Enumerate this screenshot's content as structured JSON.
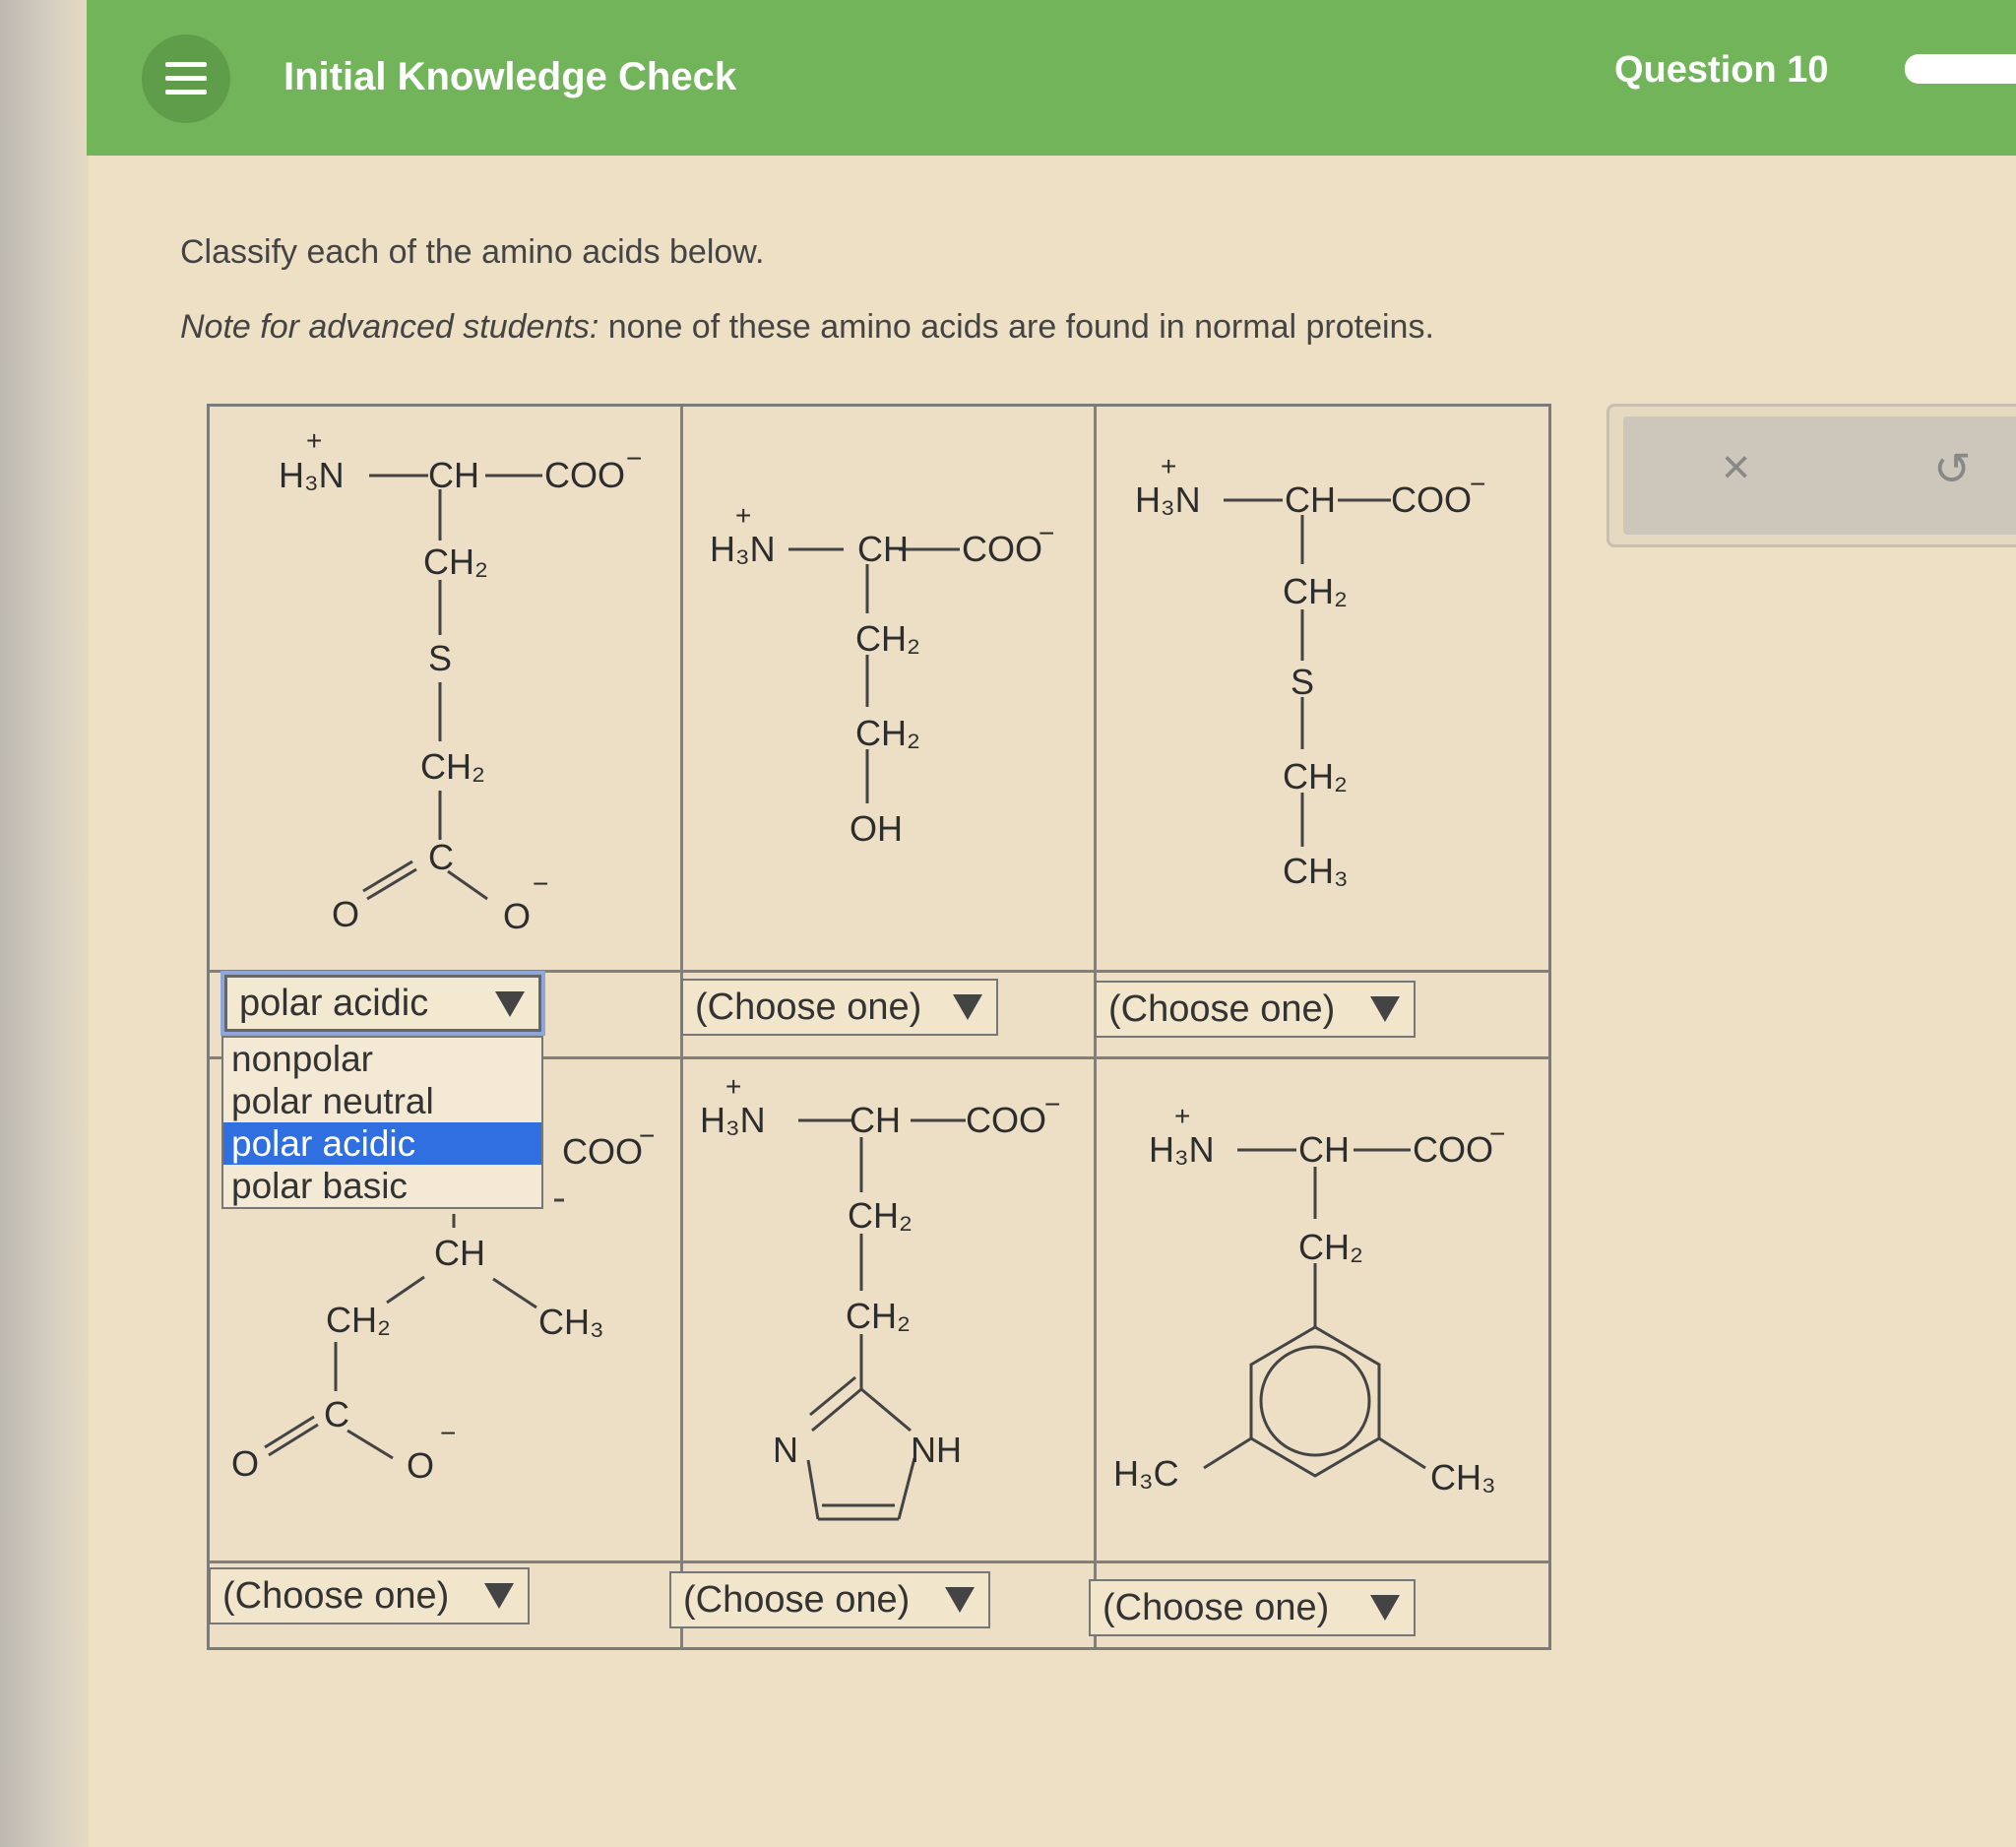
{
  "header": {
    "title": "Initial Knowledge Check",
    "question": "Question 10"
  },
  "prompt": {
    "instruction": "Classify each of the amino acids below.",
    "note_label": "Note for advanced students:",
    "note_text": " none of these amino acids are found in normal proteins."
  },
  "cells": [
    {
      "selected": "polar acidic"
    },
    {
      "selected": "(Choose one)"
    },
    {
      "selected": "(Choose one)"
    },
    {
      "selected": "(Choose one)"
    },
    {
      "selected": "(Choose one)"
    },
    {
      "selected": "(Choose one)"
    }
  ],
  "dropdown": {
    "options": [
      "nonpolar",
      "polar neutral",
      "polar acidic",
      "polar basic"
    ],
    "highlighted": "polar acidic"
  },
  "molecules": {
    "h3n": "H₃N",
    "plus": "+",
    "ch": "CH",
    "coo": "COO",
    "minus": "−",
    "ch2": "CH₂",
    "ch3": "CH₃",
    "h3c": "H₃C",
    "s": "S",
    "c": "C",
    "o": "O",
    "oh": "OH",
    "n": "N",
    "nh": "NH"
  },
  "tools": {
    "close_icon": "×",
    "undo_icon": "↺"
  },
  "colors": {
    "header_green": "#72b45a",
    "highlight_blue": "#2f6fe0",
    "background": "#ede0c4"
  }
}
